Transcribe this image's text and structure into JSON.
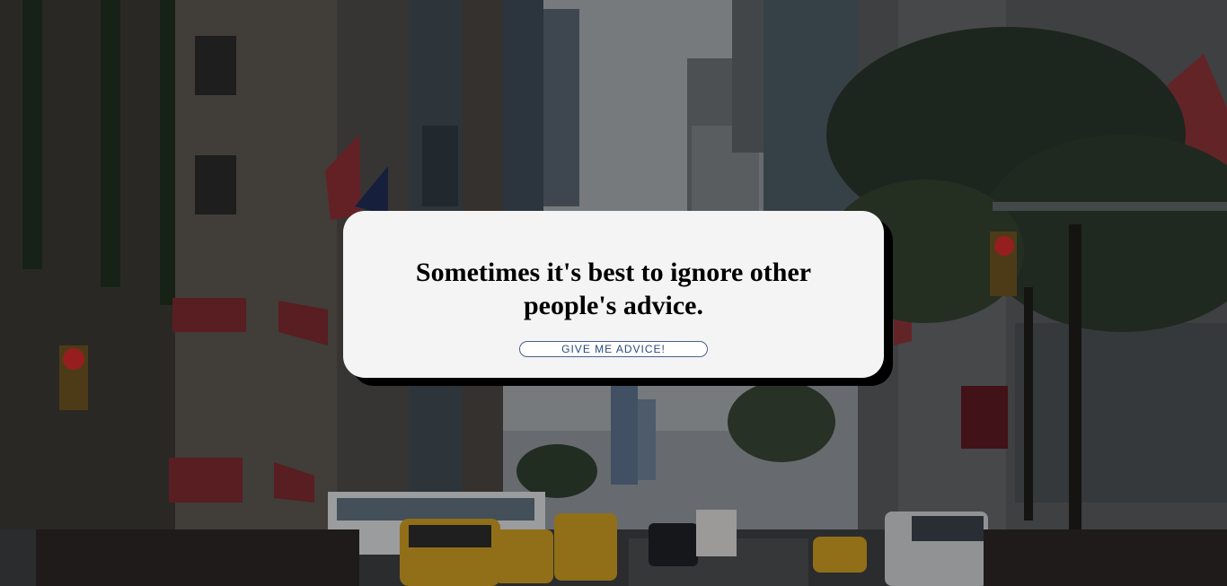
{
  "advice": {
    "text": "Sometimes it's best to ignore other people's advice."
  },
  "button": {
    "label": "GIVE ME ADVICE!"
  },
  "background": {
    "description_icon": "city-street-photo",
    "colors": {
      "sky": "#9aa0a6",
      "buildings_left": "#4b4a48",
      "buildings_right": "#5b5e60",
      "tree": "#263326",
      "taxi": "#d7a52a",
      "street": "#3e4144"
    }
  },
  "theme": {
    "card_bg": "#f4f4f4",
    "card_shadow": "#000000",
    "button_border": "#4a5f8a",
    "button_text": "#2c4a7a"
  }
}
